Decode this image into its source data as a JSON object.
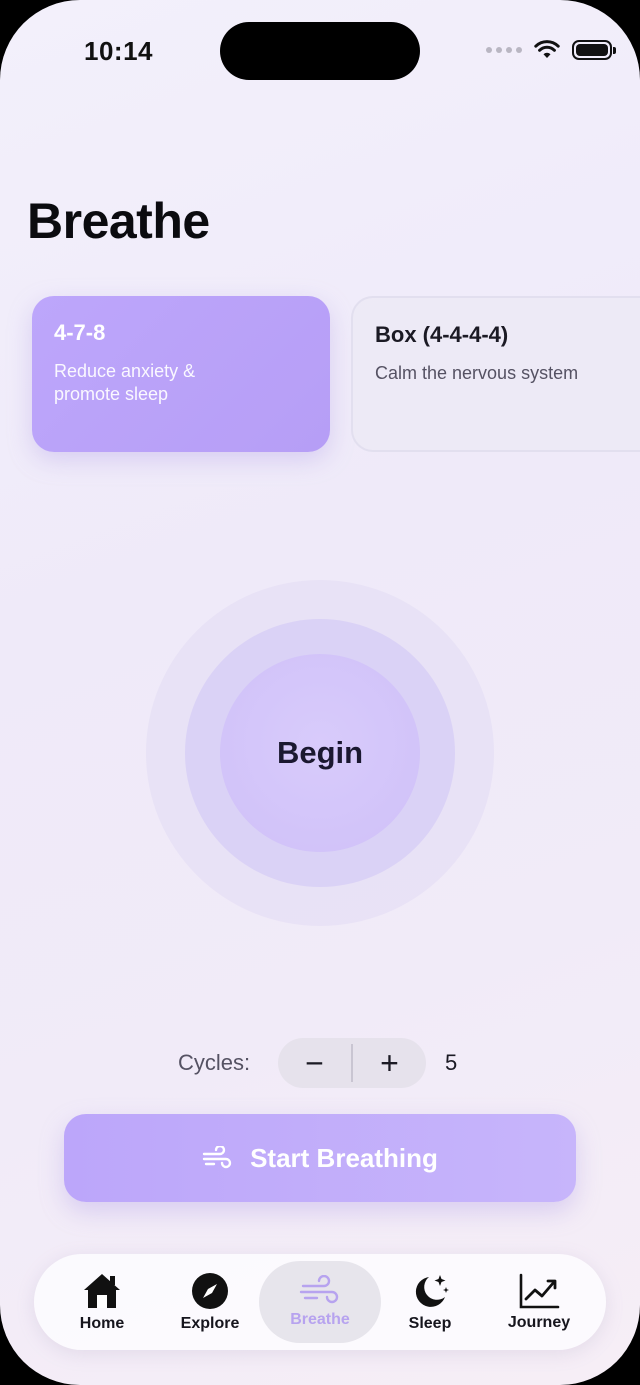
{
  "status": {
    "time": "10:14"
  },
  "page": {
    "title": "Breathe"
  },
  "techniques": [
    {
      "title": "4-7-8",
      "subtitle": "Reduce anxiety & promote sleep"
    },
    {
      "title": "Box (4-4-4-4)",
      "subtitle": "Calm the nervous system"
    }
  ],
  "circle": {
    "label": "Begin"
  },
  "cycles": {
    "label": "Cycles:",
    "minus": "−",
    "plus": "+",
    "value": "5"
  },
  "start_button": {
    "label": "Start Breathing",
    "icon": "wind-icon"
  },
  "tabbar": {
    "items": [
      {
        "label": "Home",
        "icon": "home-icon"
      },
      {
        "label": "Explore",
        "icon": "compass-icon"
      },
      {
        "label": "Breathe",
        "icon": "wind-icon",
        "active": true
      },
      {
        "label": "Sleep",
        "icon": "moon-stars-icon"
      },
      {
        "label": "Journey",
        "icon": "chart-icon"
      }
    ]
  },
  "colors": {
    "accent": "#BCA6FA",
    "active_tab_text": "#B7A3EF",
    "text": "#1B1A24"
  }
}
